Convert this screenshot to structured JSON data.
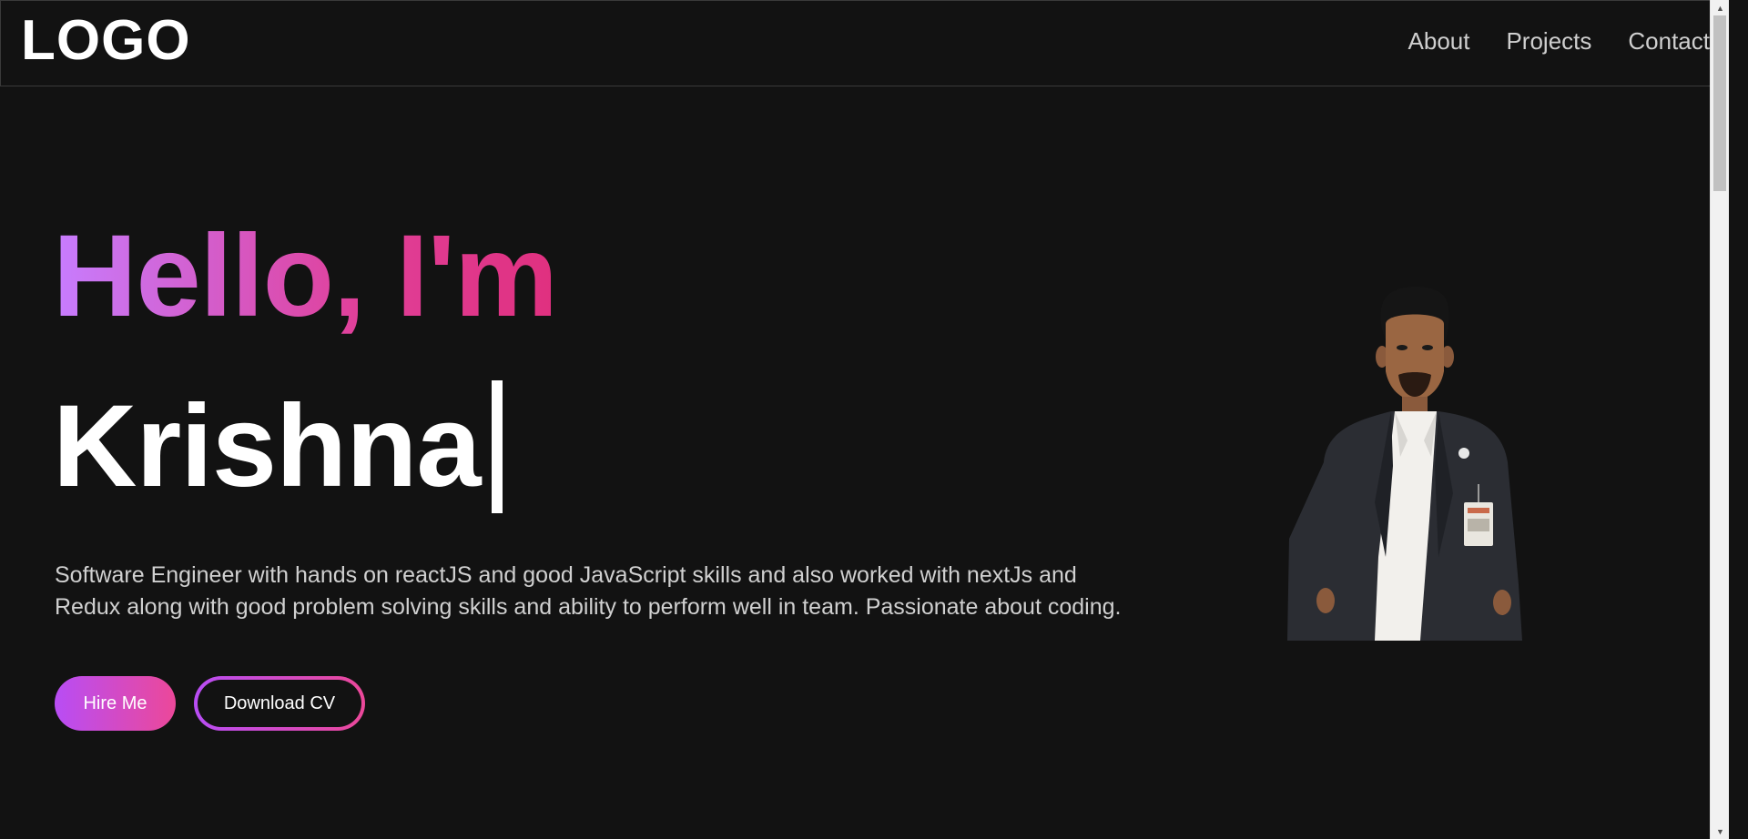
{
  "header": {
    "logo": "LOGO",
    "nav": [
      {
        "label": "About"
      },
      {
        "label": "Projects"
      },
      {
        "label": "Contact"
      }
    ]
  },
  "hero": {
    "greeting": "Hello, I'm",
    "name": "Krishna",
    "bio": "Software Engineer with hands on reactJS and good JavaScript skills and also worked with nextJs and Redux along with good problem solving skills and ability to perform well in team. Passionate about coding.",
    "buttons": {
      "primary": "Hire Me",
      "secondary": "Download CV"
    }
  },
  "colors": {
    "background": "#121212",
    "gradient_start": "#c77dff",
    "gradient_end": "#ec4899",
    "text": "#ffffff",
    "muted_text": "#d0d0d0"
  },
  "icons": {
    "cursor": "text-cursor-bar",
    "scroll_up": "scroll-up-arrow-icon",
    "scroll_down": "scroll-down-arrow-icon"
  }
}
